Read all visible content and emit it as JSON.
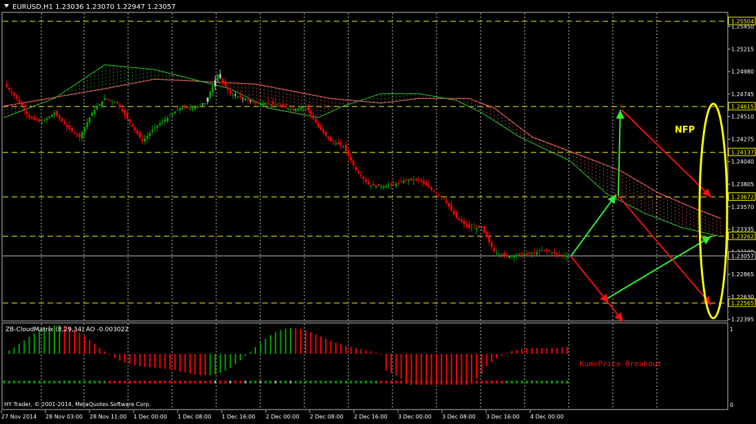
{
  "window": {
    "menu_icon": "dropdown-triangle-icon",
    "title": "EURUSD,H1  1.23036 1.23070 1.22947 1.23057"
  },
  "main_chart": {
    "price_axis_labels": [
      "1.25504",
      "1.25450",
      "1.25215",
      "1.24980",
      "1.24745",
      "1.24615",
      "1.24510",
      "1.24275",
      "1.24137",
      "1.24040",
      "1.23805",
      "1.23672",
      "1.23570",
      "1.23335",
      "1.23262",
      "1.23100",
      "1.23057",
      "1.22865",
      "1.22630",
      "1.22565",
      "1.22395"
    ],
    "highlighted_levels": [
      "1.25504",
      "1.24615",
      "1.24137",
      "1.23672",
      "1.23262",
      "1.22565"
    ],
    "current_price_label": "1.23057",
    "annotation_text": "NFP",
    "colors": {
      "bull_candle": "#00a000",
      "bear_candle": "#ff0000",
      "doji_candle": "#c0c0c0",
      "level_line": "#ffff00",
      "cloud_upper": "#ff6666",
      "cloud_lower": "#33cc33",
      "arrow_green": "#33ee33",
      "arrow_red": "#ee1111",
      "ellipse": "#ffff00"
    }
  },
  "indicator": {
    "title": "ZB-CloudMatrix (8,29,34)  AO -0.003022",
    "signal_text": "KumoPrice Breakout",
    "scale_top": "1",
    "scale_bottom": "0"
  },
  "footer": {
    "copyright": "HY Trader, © 2001-2014, MetaQuotes Software Corp."
  },
  "time_axis": {
    "labels": [
      "27 Nov 2014",
      "28 Nov 03:00",
      "28 Nov 11:00",
      "1 Dec 00:00",
      "1 Dec 08:00",
      "1 Dec 16:00",
      "2 Dec 00:00",
      "2 Dec 08:00",
      "2 Dec 16:00",
      "3 Dec 00:00",
      "3 Dec 08:00",
      "3 Dec 16:00",
      "4 Dec 00:00"
    ]
  },
  "chart_data": {
    "type": "candlestick",
    "symbol": "EURUSD",
    "timeframe": "H1",
    "ohlc_last": {
      "open": 1.23036,
      "high": 1.2307,
      "low": 1.22947,
      "close": 1.23057
    },
    "ylim": [
      1.22395,
      1.25504
    ],
    "levels": [
      1.25504,
      1.24615,
      1.24137,
      1.23672,
      1.23262,
      1.22565
    ],
    "close_path": [
      [
        0,
        1.2485
      ],
      [
        5,
        1.247
      ],
      [
        10,
        1.245
      ],
      [
        15,
        1.2445
      ],
      [
        20,
        1.2455
      ],
      [
        25,
        1.244
      ],
      [
        30,
        1.243
      ],
      [
        35,
        1.2455
      ],
      [
        40,
        1.247
      ],
      [
        45,
        1.2465
      ],
      [
        50,
        1.2445
      ],
      [
        55,
        1.2425
      ],
      [
        60,
        1.244
      ],
      [
        65,
        1.245
      ],
      [
        70,
        1.246
      ],
      [
        75,
        1.246
      ],
      [
        80,
        1.2465
      ],
      [
        85,
        1.2495
      ],
      [
        90,
        1.2475
      ],
      [
        95,
        1.247
      ],
      [
        100,
        1.2465
      ],
      [
        105,
        1.2465
      ],
      [
        110,
        1.2462
      ],
      [
        115,
        1.2458
      ],
      [
        120,
        1.2462
      ],
      [
        125,
        1.244
      ],
      [
        130,
        1.2425
      ],
      [
        135,
        1.242
      ],
      [
        140,
        1.2395
      ],
      [
        145,
        1.238
      ],
      [
        150,
        1.2378
      ],
      [
        155,
        1.238
      ],
      [
        160,
        1.2385
      ],
      [
        165,
        1.2385
      ],
      [
        170,
        1.2375
      ],
      [
        175,
        1.2365
      ],
      [
        180,
        1.2345
      ],
      [
        185,
        1.2335
      ],
      [
        190,
        1.2335
      ],
      [
        195,
        1.231
      ],
      [
        200,
        1.2305
      ],
      [
        205,
        1.2307
      ],
      [
        210,
        1.2308
      ],
      [
        215,
        1.2312
      ],
      [
        220,
        1.2307
      ],
      [
        224,
        1.23057
      ]
    ]
  }
}
